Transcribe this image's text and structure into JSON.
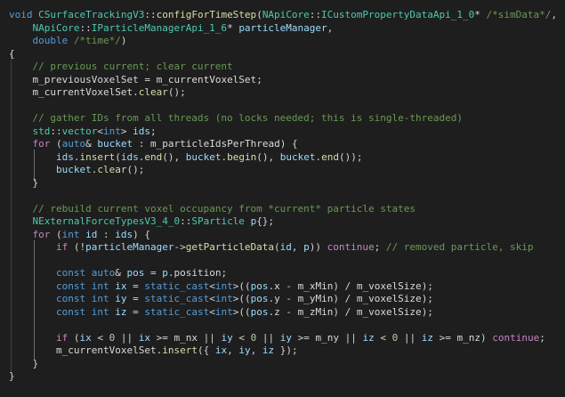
{
  "editor": {
    "lines": [
      [
        [
          "k",
          "void "
        ],
        [
          "t",
          "CSurfaceTrackingV3"
        ],
        [
          "p",
          "::"
        ],
        [
          "f",
          "configForTimeStep"
        ],
        [
          "p",
          "("
        ],
        [
          "t",
          "NApiCore"
        ],
        [
          "p",
          "::"
        ],
        [
          "t",
          "ICustomPropertyDataApi_1_0"
        ],
        [
          "p",
          "* "
        ],
        [
          "g",
          "/*simData*/"
        ],
        [
          "p",
          ","
        ]
      ],
      [
        [
          "p",
          "    "
        ],
        [
          "t",
          "NApiCore"
        ],
        [
          "p",
          "::"
        ],
        [
          "t",
          "IParticleManagerApi_1_6"
        ],
        [
          "p",
          "* "
        ],
        [
          "v",
          "particleManager"
        ],
        [
          "p",
          ","
        ]
      ],
      [
        [
          "p",
          "    "
        ],
        [
          "k",
          "double "
        ],
        [
          "g",
          "/*time*/"
        ],
        [
          "p",
          ")"
        ]
      ],
      [
        [
          "p",
          "{"
        ]
      ],
      [
        [
          "p",
          "    "
        ],
        [
          "g",
          "// previous current; clear current"
        ]
      ],
      [
        [
          "p",
          "    "
        ],
        [
          "m",
          "m_previousVoxelSet"
        ],
        [
          "p",
          " = "
        ],
        [
          "m",
          "m_currentVoxelSet"
        ],
        [
          "p",
          ";"
        ]
      ],
      [
        [
          "p",
          "    "
        ],
        [
          "m",
          "m_currentVoxelSet"
        ],
        [
          "p",
          "."
        ],
        [
          "f",
          "clear"
        ],
        [
          "p",
          "();"
        ]
      ],
      [
        [
          "p",
          ""
        ]
      ],
      [
        [
          "p",
          "    "
        ],
        [
          "g",
          "// gather IDs from all threads (no locks needed; this is single-threaded)"
        ]
      ],
      [
        [
          "p",
          "    "
        ],
        [
          "t",
          "std"
        ],
        [
          "p",
          "::"
        ],
        [
          "t",
          "vector"
        ],
        [
          "p",
          "<"
        ],
        [
          "k",
          "int"
        ],
        [
          "p",
          "> "
        ],
        [
          "v",
          "ids"
        ],
        [
          "p",
          ";"
        ]
      ],
      [
        [
          "p",
          "    "
        ],
        [
          "c",
          "for "
        ],
        [
          "p",
          "("
        ],
        [
          "k",
          "auto"
        ],
        [
          "p",
          "& "
        ],
        [
          "v",
          "bucket"
        ],
        [
          "p",
          " : "
        ],
        [
          "m",
          "m_particleIdsPerThread"
        ],
        [
          "p",
          ") {"
        ]
      ],
      [
        [
          "p",
          "        "
        ],
        [
          "v",
          "ids"
        ],
        [
          "p",
          "."
        ],
        [
          "f",
          "insert"
        ],
        [
          "p",
          "("
        ],
        [
          "v",
          "ids"
        ],
        [
          "p",
          "."
        ],
        [
          "f",
          "end"
        ],
        [
          "p",
          "(), "
        ],
        [
          "v",
          "bucket"
        ],
        [
          "p",
          "."
        ],
        [
          "f",
          "begin"
        ],
        [
          "p",
          "(), "
        ],
        [
          "v",
          "bucket"
        ],
        [
          "p",
          "."
        ],
        [
          "f",
          "end"
        ],
        [
          "p",
          "());"
        ]
      ],
      [
        [
          "p",
          "        "
        ],
        [
          "v",
          "bucket"
        ],
        [
          "p",
          "."
        ],
        [
          "f",
          "clear"
        ],
        [
          "p",
          "();"
        ]
      ],
      [
        [
          "p",
          "    }"
        ]
      ],
      [
        [
          "p",
          ""
        ]
      ],
      [
        [
          "p",
          "    "
        ],
        [
          "g",
          "// rebuild current voxel occupancy from *current* particle states"
        ]
      ],
      [
        [
          "p",
          "    "
        ],
        [
          "t",
          "NExternalForceTypesV3_4_0"
        ],
        [
          "p",
          "::"
        ],
        [
          "t",
          "SParticle "
        ],
        [
          "v",
          "p"
        ],
        [
          "p",
          "{};"
        ]
      ],
      [
        [
          "p",
          "    "
        ],
        [
          "c",
          "for "
        ],
        [
          "p",
          "("
        ],
        [
          "k",
          "int "
        ],
        [
          "v",
          "id"
        ],
        [
          "p",
          " : "
        ],
        [
          "v",
          "ids"
        ],
        [
          "p",
          ") {"
        ]
      ],
      [
        [
          "p",
          "        "
        ],
        [
          "c",
          "if "
        ],
        [
          "p",
          "(!"
        ],
        [
          "v",
          "particleManager"
        ],
        [
          "p",
          "->"
        ],
        [
          "f",
          "getParticleData"
        ],
        [
          "p",
          "("
        ],
        [
          "v",
          "id"
        ],
        [
          "p",
          ", "
        ],
        [
          "v",
          "p"
        ],
        [
          "p",
          ")) "
        ],
        [
          "c",
          "continue"
        ],
        [
          "p",
          "; "
        ],
        [
          "g",
          "// removed particle, skip"
        ]
      ],
      [
        [
          "p",
          ""
        ]
      ],
      [
        [
          "p",
          "        "
        ],
        [
          "k",
          "const auto"
        ],
        [
          "p",
          "& "
        ],
        [
          "v",
          "pos"
        ],
        [
          "p",
          " = "
        ],
        [
          "v",
          "p"
        ],
        [
          "p",
          "."
        ],
        [
          "m",
          "position"
        ],
        [
          "p",
          ";"
        ]
      ],
      [
        [
          "p",
          "        "
        ],
        [
          "k",
          "const int "
        ],
        [
          "v",
          "ix"
        ],
        [
          "p",
          " = "
        ],
        [
          "k",
          "static_cast"
        ],
        [
          "p",
          "<"
        ],
        [
          "k",
          "int"
        ],
        [
          "p",
          ">(("
        ],
        [
          "v",
          "pos"
        ],
        [
          "p",
          "."
        ],
        [
          "m",
          "x"
        ],
        [
          "p",
          " - "
        ],
        [
          "m",
          "m_xMin"
        ],
        [
          "p",
          ") / "
        ],
        [
          "m",
          "m_voxelSize"
        ],
        [
          "p",
          ");"
        ]
      ],
      [
        [
          "p",
          "        "
        ],
        [
          "k",
          "const int "
        ],
        [
          "v",
          "iy"
        ],
        [
          "p",
          " = "
        ],
        [
          "k",
          "static_cast"
        ],
        [
          "p",
          "<"
        ],
        [
          "k",
          "int"
        ],
        [
          "p",
          ">(("
        ],
        [
          "v",
          "pos"
        ],
        [
          "p",
          "."
        ],
        [
          "m",
          "y"
        ],
        [
          "p",
          " - "
        ],
        [
          "m",
          "m_yMin"
        ],
        [
          "p",
          ") / "
        ],
        [
          "m",
          "m_voxelSize"
        ],
        [
          "p",
          ");"
        ]
      ],
      [
        [
          "p",
          "        "
        ],
        [
          "k",
          "const int "
        ],
        [
          "v",
          "iz"
        ],
        [
          "p",
          " = "
        ],
        [
          "k",
          "static_cast"
        ],
        [
          "p",
          "<"
        ],
        [
          "k",
          "int"
        ],
        [
          "p",
          ">(("
        ],
        [
          "v",
          "pos"
        ],
        [
          "p",
          "."
        ],
        [
          "m",
          "z"
        ],
        [
          "p",
          " - "
        ],
        [
          "m",
          "m_zMin"
        ],
        [
          "p",
          ") / "
        ],
        [
          "m",
          "m_voxelSize"
        ],
        [
          "p",
          ");"
        ]
      ],
      [
        [
          "p",
          ""
        ]
      ],
      [
        [
          "p",
          "        "
        ],
        [
          "c",
          "if "
        ],
        [
          "p",
          "("
        ],
        [
          "v",
          "ix"
        ],
        [
          "p",
          " < "
        ],
        [
          "n",
          "0"
        ],
        [
          "p",
          " || "
        ],
        [
          "v",
          "ix"
        ],
        [
          "p",
          " >= "
        ],
        [
          "m",
          "m_nx"
        ],
        [
          "p",
          " || "
        ],
        [
          "v",
          "iy"
        ],
        [
          "p",
          " < "
        ],
        [
          "n",
          "0"
        ],
        [
          "p",
          " || "
        ],
        [
          "v",
          "iy"
        ],
        [
          "p",
          " >= "
        ],
        [
          "m",
          "m_ny"
        ],
        [
          "p",
          " || "
        ],
        [
          "v",
          "iz"
        ],
        [
          "p",
          " < "
        ],
        [
          "n",
          "0"
        ],
        [
          "p",
          " || "
        ],
        [
          "v",
          "iz"
        ],
        [
          "p",
          " >= "
        ],
        [
          "m",
          "m_nz"
        ],
        [
          "p",
          ") "
        ],
        [
          "c",
          "continue"
        ],
        [
          "p",
          ";"
        ]
      ],
      [
        [
          "p",
          "        "
        ],
        [
          "m",
          "m_currentVoxelSet"
        ],
        [
          "p",
          "."
        ],
        [
          "f",
          "insert"
        ],
        [
          "p",
          "({ "
        ],
        [
          "v",
          "ix"
        ],
        [
          "p",
          ", "
        ],
        [
          "v",
          "iy"
        ],
        [
          "p",
          ", "
        ],
        [
          "v",
          "iz"
        ],
        [
          "p",
          " });"
        ]
      ],
      [
        [
          "p",
          "    }"
        ]
      ],
      [
        [
          "p",
          "}"
        ]
      ]
    ]
  }
}
